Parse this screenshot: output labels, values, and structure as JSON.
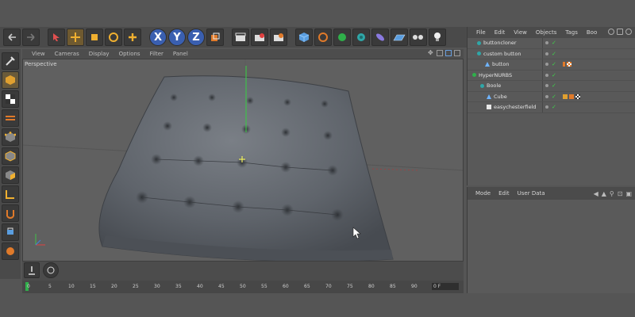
{
  "viewport": {
    "label": "Perspective",
    "menu": [
      "View",
      "Cameras",
      "Display",
      "Options",
      "Filter",
      "Panel"
    ]
  },
  "object_manager": {
    "menu": [
      "File",
      "Edit",
      "View",
      "Objects",
      "Tags",
      "Boo"
    ],
    "objects": [
      {
        "name": "buttoncloner",
        "indent": 1,
        "icon": "cloner-icon"
      },
      {
        "name": "custom button",
        "indent": 1,
        "icon": "null-icon"
      },
      {
        "name": "button",
        "indent": 2,
        "icon": "spline-icon"
      },
      {
        "name": "HyperNURBS",
        "indent": 1,
        "icon": "hypernurbs-icon"
      },
      {
        "name": "Boole",
        "indent": 2,
        "icon": "boole-icon"
      },
      {
        "name": "Cube",
        "indent": 3,
        "icon": "cube-icon"
      },
      {
        "name": "easychesterfield",
        "indent": 3,
        "icon": "mesh-icon"
      }
    ]
  },
  "attributes_manager": {
    "menu": [
      "Mode",
      "Edit",
      "User Data"
    ]
  },
  "timeline": {
    "frames": [
      "0",
      "5",
      "10",
      "15",
      "20",
      "25",
      "30",
      "35",
      "40",
      "45",
      "50",
      "55",
      "60",
      "65",
      "70",
      "75",
      "80",
      "85",
      "90"
    ],
    "current_field": "0 F"
  },
  "colors": {
    "accent_green": "#2fb04a",
    "teal": "#2fa7a8",
    "object_blue": "#5a9ee0"
  }
}
